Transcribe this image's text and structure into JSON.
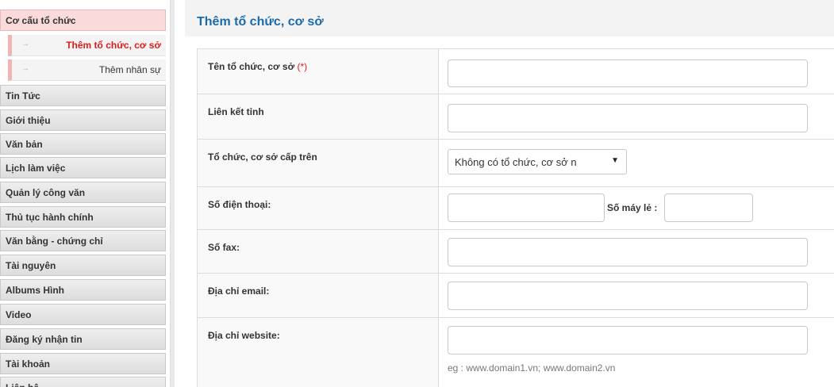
{
  "sidebar": {
    "items": [
      {
        "label": "Cơ cấu tổ chức"
      },
      {
        "label": "Tin Tức"
      },
      {
        "label": "Giới thiệu"
      },
      {
        "label": "Văn bản"
      },
      {
        "label": "Lịch làm việc"
      },
      {
        "label": "Quản lý công văn"
      },
      {
        "label": "Thủ tục hành chính"
      },
      {
        "label": "Văn bằng - chứng chỉ"
      },
      {
        "label": "Tài nguyên"
      },
      {
        "label": "Albums Hình"
      },
      {
        "label": "Video"
      },
      {
        "label": "Đăng ký nhận tin"
      },
      {
        "label": "Tài khoản"
      },
      {
        "label": "Liên hệ"
      }
    ],
    "subitems": [
      {
        "label": "Thêm tổ chức, cơ sở",
        "arrow": "→"
      },
      {
        "label": "Thêm nhân sự",
        "arrow": "→"
      }
    ]
  },
  "page": {
    "title": "Thêm tổ chức, cơ sở"
  },
  "form": {
    "name_label": "Tên tổ chức, cơ sở",
    "required_mark": "(*)",
    "link_label": "Liên kết tỉnh",
    "parent_label": "Tổ chức, cơ sở cấp trên",
    "parent_selected": "Không có tổ chức, cơ sở n",
    "parent_caret": "▼",
    "phone_label": "Số điện thoại:",
    "ext_label": "Số máy lẻ :",
    "fax_label": "Số fax:",
    "email_label": "Địa chỉ email:",
    "website_label": "Địa chỉ website:",
    "website_hint": "eg : www.domain1.vn; www.domain2.vn"
  },
  "colors": {
    "accent": "#1c6aa8",
    "active_bg": "#fadada",
    "required": "#e01919"
  }
}
